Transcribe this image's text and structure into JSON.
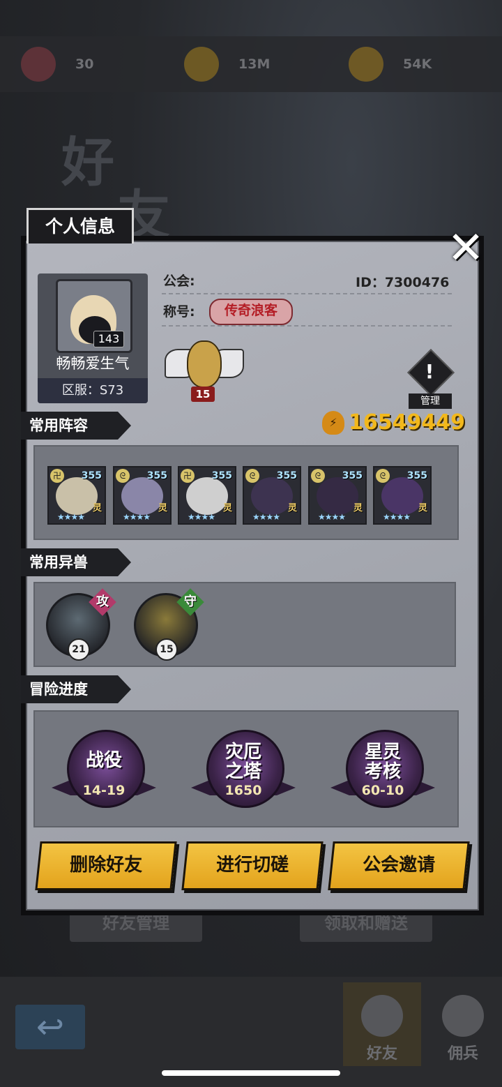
{
  "resources": [
    {
      "icon": "heart-icon",
      "value": "30"
    },
    {
      "icon": "coin-icon",
      "value": "13M"
    },
    {
      "icon": "key-icon",
      "value": "54K"
    }
  ],
  "background_title": [
    "好",
    "友"
  ],
  "background_buttons": {
    "friend_manage": "好友管理",
    "receive_send": "领取和赠送"
  },
  "bottom_nav": [
    {
      "icon": "handshake-icon",
      "label": "好友",
      "active": true
    },
    {
      "icon": "people-icon",
      "label": "佣兵",
      "active": false
    }
  ],
  "modal": {
    "tab_title": "个人信息",
    "close": "✕",
    "player": {
      "level": "143",
      "name": "畅畅爱生气",
      "server": "区服：S73",
      "guild_label": "公会:",
      "guild_value": "",
      "id_text": "ID：7300476",
      "title_label": "称号:",
      "title_badge": "传奇浪客",
      "rank_level": "15",
      "manage_label": "管理",
      "manage_symbol": "!",
      "power": "16549449"
    },
    "sections": {
      "lineup": "常用阵容",
      "beasts": "常用异兽",
      "adventure": "冒险进度"
    },
    "heroes": [
      {
        "level": "355",
        "element": "卍",
        "spec": "灵",
        "stars": "★★★★",
        "color": "#c9c0a8"
      },
      {
        "level": "355",
        "element": "ᘓ",
        "spec": "灵",
        "stars": "★★★★",
        "color": "#8a86a8"
      },
      {
        "level": "355",
        "element": "卍",
        "spec": "灵",
        "stars": "★★★★",
        "color": "#cfcfcf"
      },
      {
        "level": "355",
        "element": "ᘓ",
        "spec": "灵",
        "stars": "★★★★",
        "color": "#3d3350"
      },
      {
        "level": "355",
        "element": "ᘓ",
        "spec": "灵",
        "stars": "★★★★",
        "color": "#352a44"
      },
      {
        "level": "355",
        "element": "ᘓ",
        "spec": "灵",
        "stars": "★★★★",
        "color": "#4a3566"
      }
    ],
    "beasts": [
      {
        "level": "21",
        "tag": "攻",
        "tag_color": "#b23a6a",
        "color": "#5d6a73"
      },
      {
        "level": "15",
        "tag": "守",
        "tag_color": "#3a8a3a",
        "color": "#8a7a3a"
      }
    ],
    "progress": [
      {
        "title": "战役",
        "value": "14-19"
      },
      {
        "title": "灾厄\n之塔",
        "value": "1650"
      },
      {
        "title": "星灵\n考核",
        "value": "60-10"
      }
    ],
    "actions": {
      "delete": "删除好友",
      "spar": "进行切磋",
      "invite": "公会邀请"
    }
  }
}
